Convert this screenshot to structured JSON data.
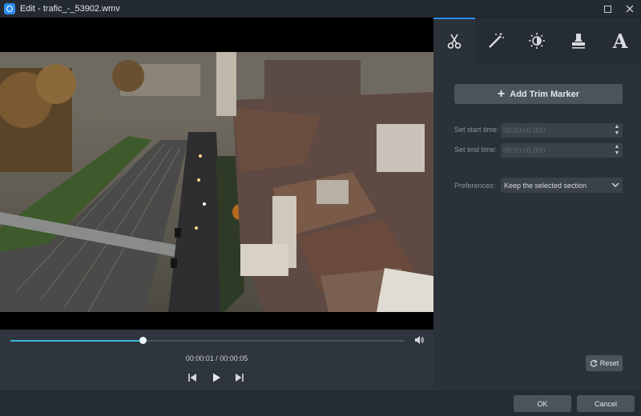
{
  "window": {
    "title": "Edit - trafic_-_53902.wmv",
    "icon": "app-logo-icon",
    "controls": [
      "minimize-icon",
      "maximize-icon",
      "close-icon"
    ]
  },
  "player": {
    "progress": 0.335,
    "time_display": "00:00:01 / 00:00:05",
    "accent_color": "#3fb6d8"
  },
  "tabs": [
    {
      "name": "trim",
      "icon": "scissors-icon",
      "active": true
    },
    {
      "name": "effects",
      "icon": "magic-wand-icon",
      "active": false
    },
    {
      "name": "adjust",
      "icon": "brightness-icon",
      "active": false
    },
    {
      "name": "watermark",
      "icon": "stamp-icon",
      "active": false
    },
    {
      "name": "text",
      "icon": "text-icon",
      "label": "A",
      "active": false
    }
  ],
  "trim": {
    "add_marker_label": "Add Trim Marker",
    "start_label": "Set start time:",
    "start_value": "00:00:00.000",
    "end_label": "Set end time:",
    "end_value": "00:00:00.000",
    "preferences_label": "Preferences:",
    "preferences_value": "Keep the selected section",
    "reset_label": "Reset"
  },
  "footer": {
    "ok_label": "OK",
    "cancel_label": "Cancel"
  }
}
